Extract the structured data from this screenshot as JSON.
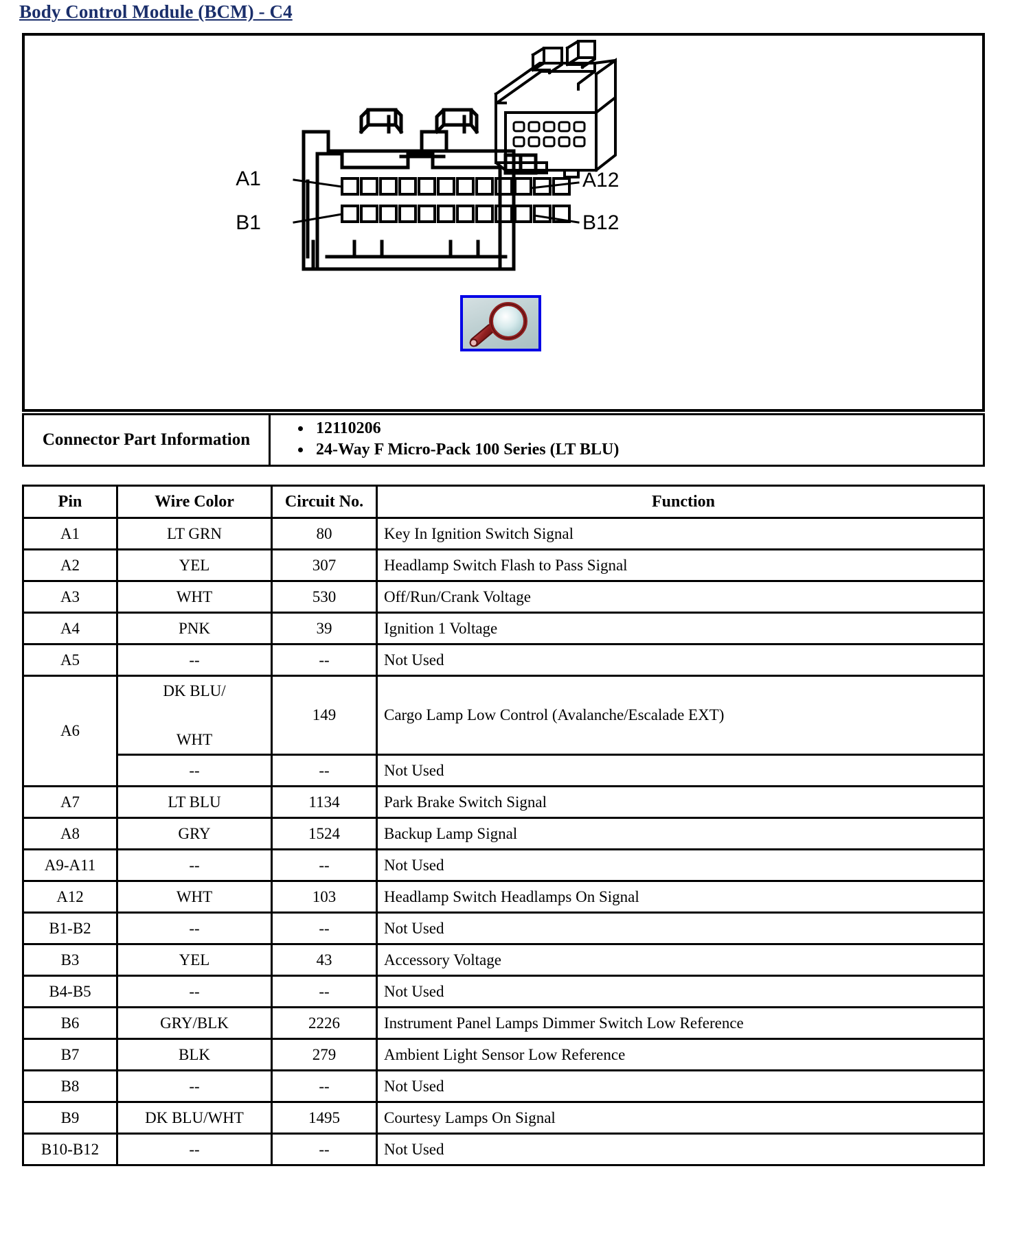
{
  "page": {
    "title": "Body Control Module (BCM) - C4",
    "title_color": "#1b2f6b"
  },
  "illustration": {
    "name": "connector-face-diagram",
    "labels": {
      "top_left": "A1",
      "bottom_left": "B1",
      "top_right": "A12",
      "bottom_right": "B12"
    },
    "pin_rows": 2,
    "pins_per_row": 12,
    "magnifier": {
      "icon": "magnifier-icon",
      "border_color": "#0000e6",
      "glass_color": "#8b1a1a",
      "lens_color": "#cfe6e8"
    }
  },
  "connector_part_information": {
    "label": "Connector Part Information",
    "items": [
      "12110206",
      "24-Way F Micro-Pack 100 Series (LT BLU)"
    ]
  },
  "pin_table": {
    "headers": {
      "pin": "Pin",
      "wire_color": "Wire Color",
      "circuit_no": "Circuit No.",
      "function": "Function"
    },
    "rows": [
      {
        "pin": "A1",
        "wire": "LT GRN",
        "circuit": "80",
        "function": "Key In Ignition Switch Signal"
      },
      {
        "pin": "A2",
        "wire": "YEL",
        "circuit": "307",
        "function": "Headlamp Switch Flash to Pass Signal"
      },
      {
        "pin": "A3",
        "wire": "WHT",
        "circuit": "530",
        "function": "Off/Run/Crank Voltage"
      },
      {
        "pin": "A4",
        "wire": "PNK",
        "circuit": "39",
        "function": "Ignition 1 Voltage"
      },
      {
        "pin": "A5",
        "wire": "--",
        "circuit": "--",
        "function": "Not Used"
      },
      {
        "pin": "A7",
        "wire": "LT BLU",
        "circuit": "1134",
        "function": "Park Brake Switch Signal"
      },
      {
        "pin": "A8",
        "wire": "GRY",
        "circuit": "1524",
        "function": "Backup Lamp Signal"
      },
      {
        "pin": "A9-A11",
        "wire": "--",
        "circuit": "--",
        "function": "Not Used"
      },
      {
        "pin": "A12",
        "wire": "WHT",
        "circuit": "103",
        "function": "Headlamp Switch Headlamps On Signal"
      },
      {
        "pin": "B1-B2",
        "wire": "--",
        "circuit": "--",
        "function": "Not Used"
      },
      {
        "pin": "B3",
        "wire": "YEL",
        "circuit": "43",
        "function": "Accessory Voltage"
      },
      {
        "pin": "B4-B5",
        "wire": "--",
        "circuit": "--",
        "function": "Not Used"
      },
      {
        "pin": "B6",
        "wire": "GRY/BLK",
        "circuit": "2226",
        "function": "Instrument Panel Lamps Dimmer Switch Low Reference"
      },
      {
        "pin": "B7",
        "wire": "BLK",
        "circuit": "279",
        "function": "Ambient Light Sensor Low Reference"
      },
      {
        "pin": "B8",
        "wire": "--",
        "circuit": "--",
        "function": "Not Used"
      },
      {
        "pin": "B9",
        "wire": "DK BLU/WHT",
        "circuit": "1495",
        "function": "Courtesy Lamps On Signal"
      },
      {
        "pin": "B10-B12",
        "wire": "--",
        "circuit": "--",
        "function": "Not Used"
      }
    ],
    "a6_group": {
      "pin": "A6",
      "sub_rows": [
        {
          "wire_line1": "DK BLU/",
          "wire_line2": "WHT",
          "circuit": "149",
          "function": "Cargo Lamp Low Control (Avalanche/Escalade EXT)"
        },
        {
          "wire_line1": "--",
          "wire_line2": "",
          "circuit": "--",
          "function": "Not Used"
        }
      ]
    }
  }
}
